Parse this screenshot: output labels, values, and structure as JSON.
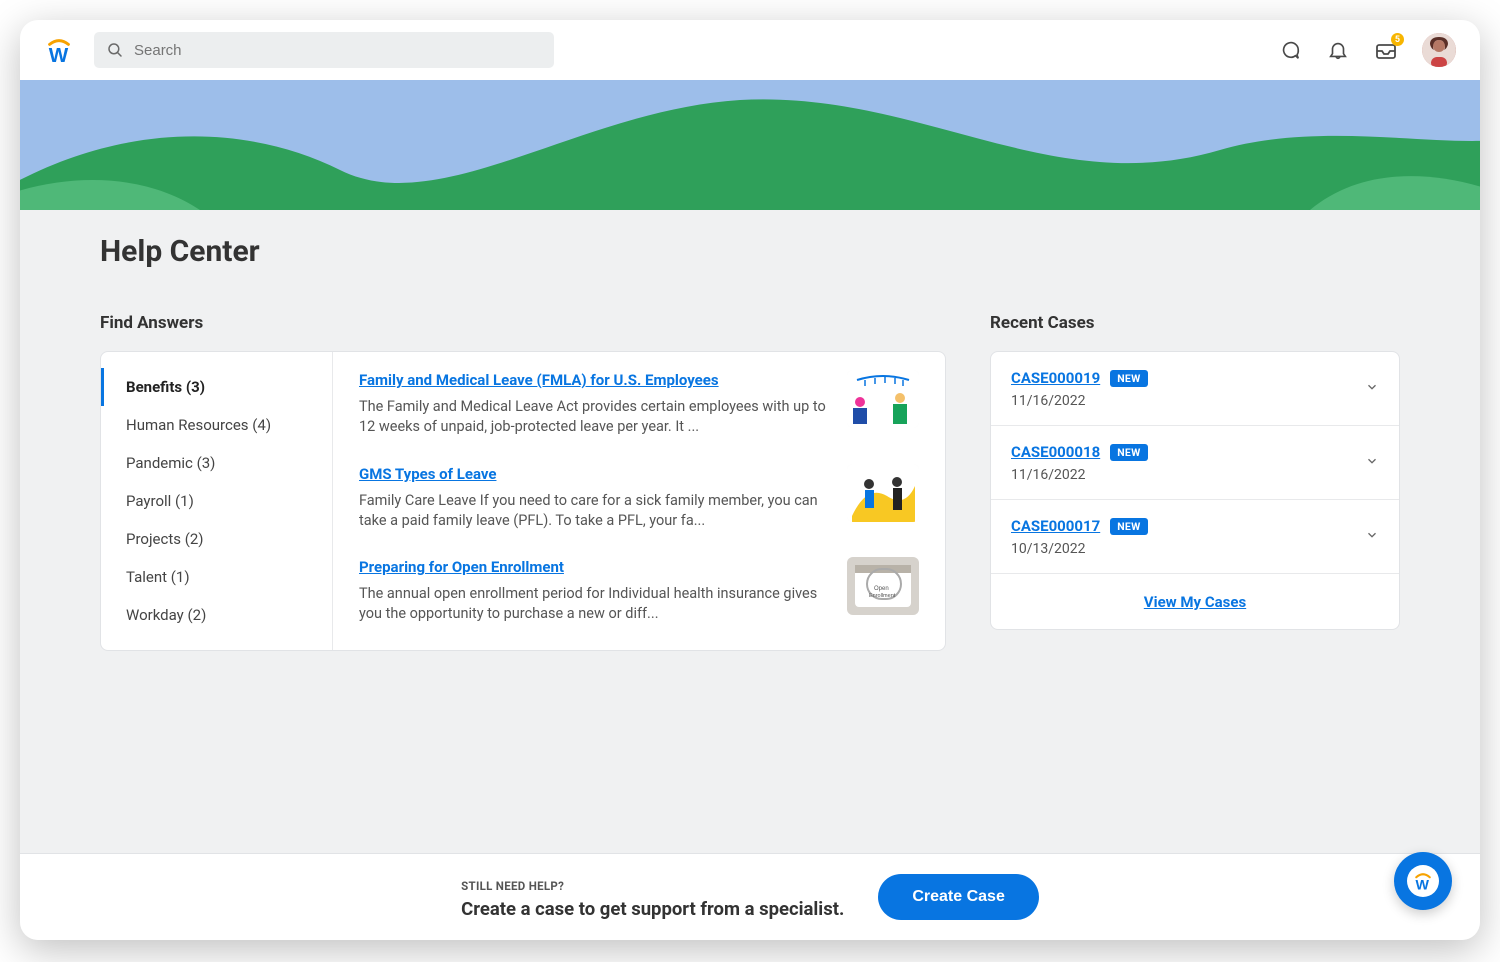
{
  "search": {
    "placeholder": "Search"
  },
  "inbox_badge": "5",
  "page_title": "Help Center",
  "find_answers": {
    "title": "Find Answers",
    "categories": [
      {
        "label": "Benefits (3)",
        "active": true
      },
      {
        "label": "Human Resources (4)",
        "active": false
      },
      {
        "label": "Pandemic (3)",
        "active": false
      },
      {
        "label": "Payroll (1)",
        "active": false
      },
      {
        "label": "Projects (2)",
        "active": false
      },
      {
        "label": "Talent (1)",
        "active": false
      },
      {
        "label": "Workday (2)",
        "active": false
      }
    ],
    "articles": [
      {
        "title": "Family and Medical Leave (FMLA) for U.S. Employees",
        "desc": "The Family and Medical Leave Act provides certain employees with up to 12 weeks of unpaid, job-protected leave per year. It ..."
      },
      {
        "title": "GMS Types of Leave",
        "desc": "Family Care Leave If you need to care for a sick family member, you can take a paid family leave (PFL). To take a PFL, your fa..."
      },
      {
        "title": "Preparing for Open Enrollment",
        "desc": "The annual open enrollment period for Individual health insurance gives you the opportunity to purchase a new or diff..."
      }
    ]
  },
  "recent_cases": {
    "title": "Recent Cases",
    "items": [
      {
        "id": "CASE000019",
        "badge": "NEW",
        "date": "11/16/2022"
      },
      {
        "id": "CASE000018",
        "badge": "NEW",
        "date": "11/16/2022"
      },
      {
        "id": "CASE000017",
        "badge": "NEW",
        "date": "10/13/2022"
      }
    ],
    "view_all": "View My Cases"
  },
  "footer": {
    "eyebrow": "STILL NEED HELP?",
    "text": "Create a case to get support from a specialist.",
    "button": "Create Case"
  }
}
